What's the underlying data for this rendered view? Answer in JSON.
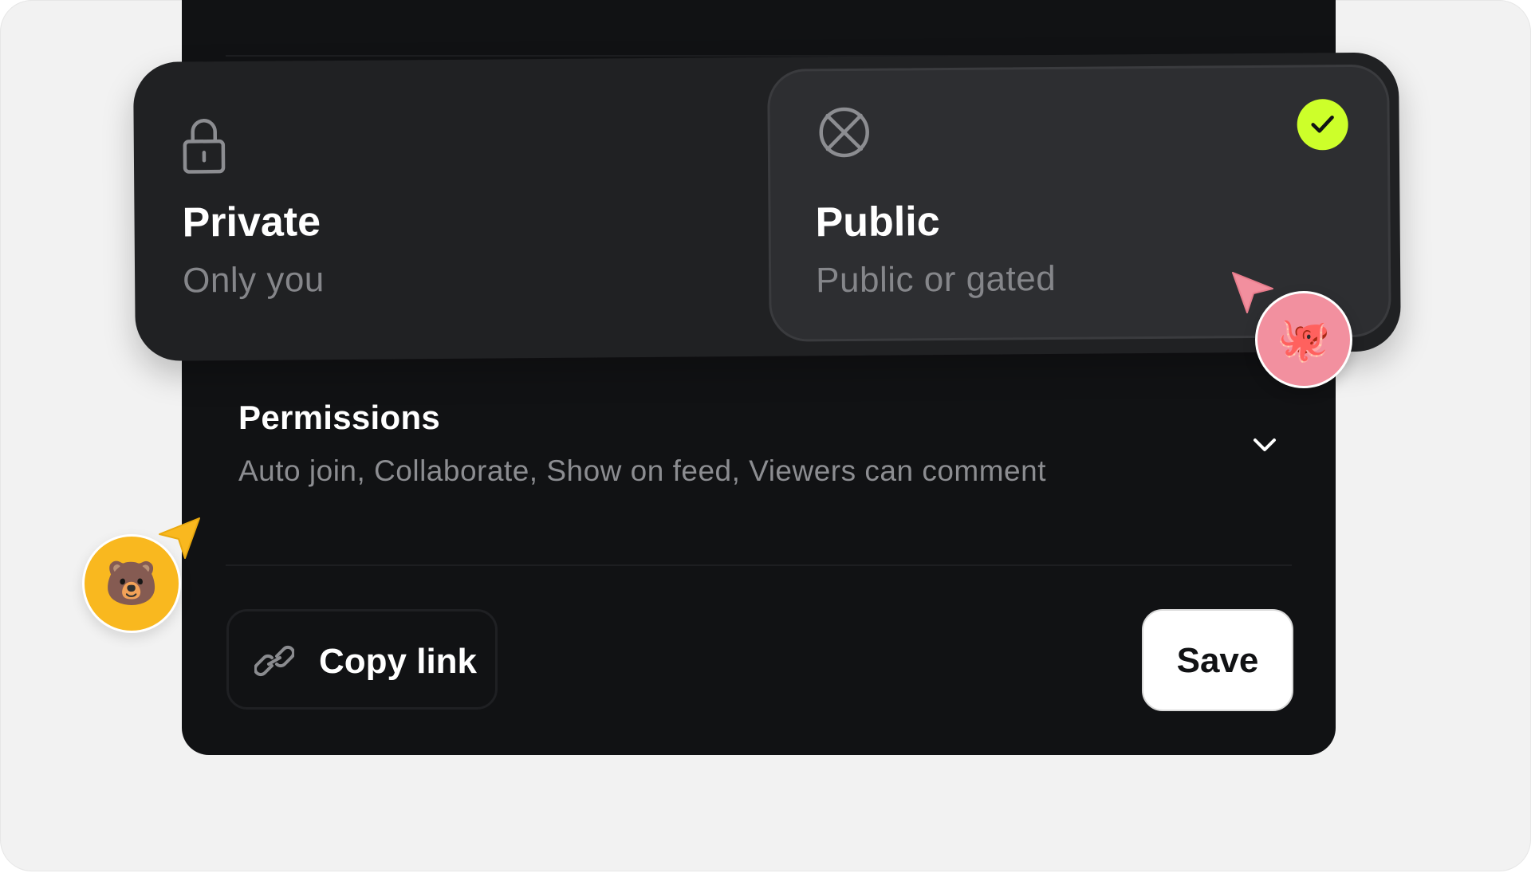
{
  "visibility": {
    "options": [
      {
        "title": "Private",
        "subtitle": "Only you",
        "icon": "lock-icon",
        "selected": false
      },
      {
        "title": "Public",
        "subtitle": "Public or gated",
        "icon": "globe-slash-icon",
        "selected": true
      }
    ],
    "selected_badge_icon": "check-icon",
    "accent_color": "#cdff2a"
  },
  "permissions": {
    "title": "Permissions",
    "summary": "Auto join, Collaborate, Show on feed, Viewers can comment",
    "icon": "chevron-down-icon"
  },
  "footer": {
    "copy_link_label": "Copy link",
    "copy_link_icon": "link-icon",
    "save_label": "Save"
  },
  "collaborators": [
    {
      "avatar": "🐙",
      "color": "#f2909f",
      "cursor_color": "#f28f9e"
    },
    {
      "avatar": "🐻",
      "color": "#f9b81f",
      "cursor_color": "#f9b81f"
    }
  ]
}
